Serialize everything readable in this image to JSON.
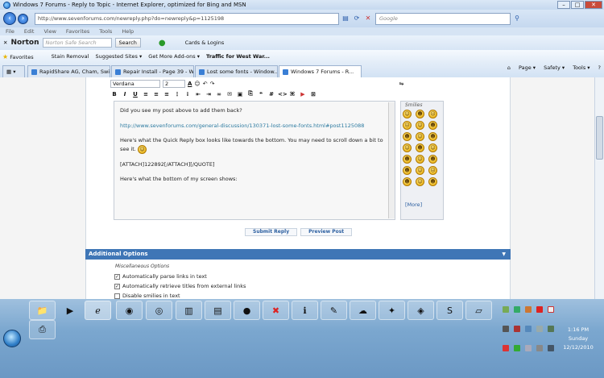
{
  "window": {
    "title": "Windows 7 Forums - Reply to Topic - Internet Explorer, optimized for Bing and MSN",
    "min": "–",
    "max": "□",
    "close": "✕"
  },
  "address": {
    "url": "http://www.sevenforums.com/newreply.php?do=newreply&p=1125198",
    "search_placeholder": "Google"
  },
  "menu": [
    "File",
    "Edit",
    "View",
    "Favorites",
    "Tools",
    "Help"
  ],
  "norton": {
    "logo": "Norton",
    "search_placeholder": "Norton Safe Search",
    "search_button": "Search",
    "cards": "Cards & Logins"
  },
  "favorites": {
    "label": "Favorites",
    "items": [
      "Stain Removal",
      "Suggested Sites ▾",
      "Get More Add-ons ▾",
      "Traffic for West War..."
    ]
  },
  "tabs": [
    {
      "label": "RapidShare AG, Cham, Swi...",
      "active": false
    },
    {
      "label": "Repair Install - Page 39 - W...",
      "active": false
    },
    {
      "label": "Lost some fonts - Window...",
      "active": false
    },
    {
      "label": "Windows 7 Forums - R...",
      "active": true
    }
  ],
  "commandbar": [
    "Page ▾",
    "Safety ▾",
    "Tools ▾"
  ],
  "editor": {
    "font": "Verdana",
    "size": "2",
    "text": {
      "p1": "Did you see my post above to add them back?",
      "p2": "http://www.sevenforums.com/general-discussion/130371-lost-some-fonts.html#post1125088",
      "p3": "Here's what the Quick Reply box looks like towards the bottom. You may need to scroll down a bit to see it.",
      "p4": "[ATTACH]122892[/ATTACH][/QUOTE]",
      "p5": "Here's what the bottom of my screen shows:"
    }
  },
  "smilies": {
    "title": "Smilies",
    "more": "[More]",
    "faces": [
      "☺",
      "☻",
      "☹",
      "☹",
      "☺",
      "☻",
      "☻",
      "☺",
      "☻",
      "☺",
      "☻",
      "☺",
      "☻",
      "☺",
      "☻",
      "☻",
      "☺",
      "☹",
      "☻",
      "☺",
      "☻"
    ]
  },
  "actions": {
    "submit": "Submit Reply",
    "preview": "Preview Post"
  },
  "additional_options": {
    "title": "Additional Options",
    "misc_title": "Miscellaneous Options",
    "options": [
      {
        "label": "Automatically parse links in text",
        "checked": true
      },
      {
        "label": "Automatically retrieve titles from external links",
        "checked": true
      },
      {
        "label": "Disable smilies in text",
        "checked": false
      }
    ]
  },
  "clock": {
    "time": "1:16 PM",
    "day": "Sunday",
    "date": "12/12/2010"
  }
}
